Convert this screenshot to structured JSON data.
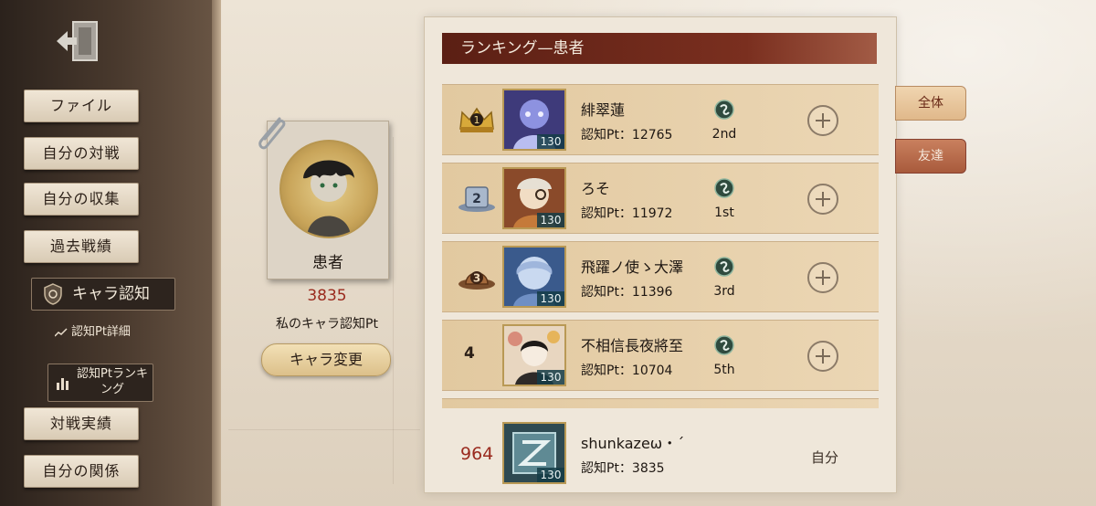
{
  "sidebar": {
    "items": [
      {
        "label": "ファイル"
      },
      {
        "label": "自分の対戦"
      },
      {
        "label": "自分の収集"
      },
      {
        "label": "過去戦績"
      },
      {
        "label": "キャラ認知"
      },
      {
        "label": "認知Pt詳細"
      },
      {
        "label": "認知Ptランキング"
      },
      {
        "label": "対戦実績"
      },
      {
        "label": "自分の関係"
      }
    ]
  },
  "character": {
    "name": "患者",
    "score": "3835",
    "score_label": "私のキャラ認知Pt",
    "change_button": "キャラ変更"
  },
  "ranking": {
    "title": "ランキング—患者",
    "rows": [
      {
        "rank": "1",
        "name": "緋翠蓮",
        "pt": "認知Pt：12765",
        "level": "130",
        "place": "2nd",
        "avatar_color": "#6a6fc4"
      },
      {
        "rank": "2",
        "name": "ろそ",
        "pt": "認知Pt：11972",
        "level": "130",
        "place": "1st",
        "avatar_color": "#c9a070"
      },
      {
        "rank": "3",
        "name": "飛躍ノ使ゝ大澤",
        "pt": "認知Pt：11396",
        "level": "130",
        "place": "3rd",
        "avatar_color": "#8fa7cf"
      },
      {
        "rank": "4",
        "name": "不相信長夜將至",
        "pt": "認知Pt：10704",
        "level": "130",
        "place": "5th",
        "avatar_color": "#d8b49a"
      }
    ],
    "self": {
      "rank": "964",
      "name": "shunkazeω・´",
      "pt": "認知Pt：3835",
      "level": "130",
      "tag": "自分"
    }
  },
  "tabs": {
    "all": "全体",
    "friends": "友達"
  }
}
